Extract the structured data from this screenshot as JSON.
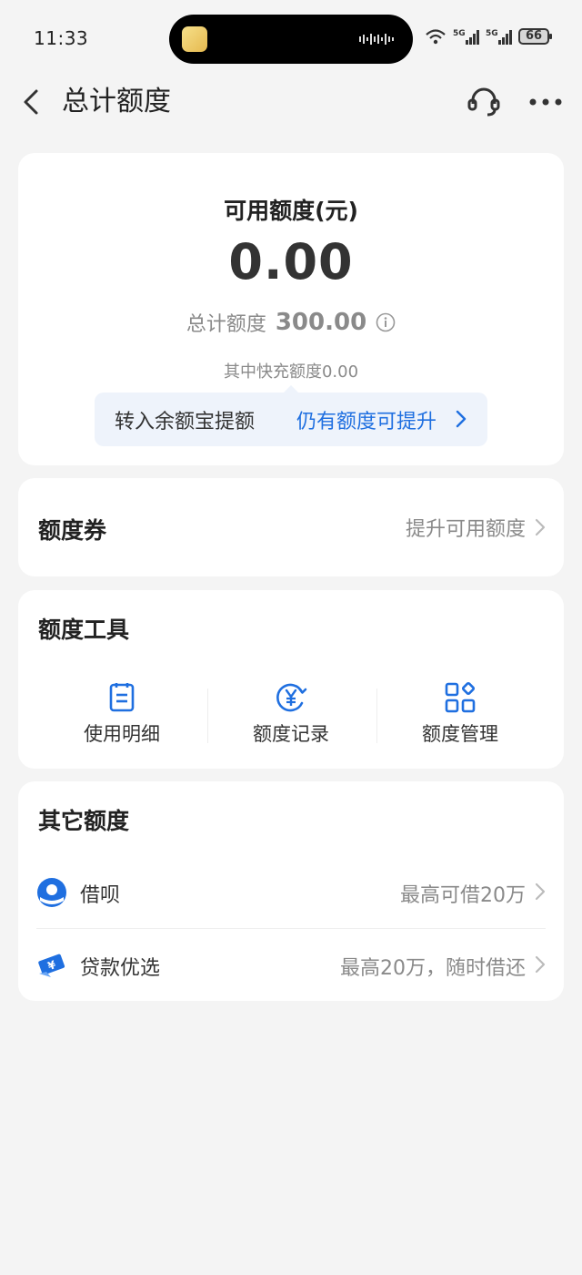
{
  "status_bar": {
    "time": "11:33",
    "battery": "66"
  },
  "nav": {
    "title": "总计额度"
  },
  "quota": {
    "available_label": "可用额度(元)",
    "available_amount": "0.00",
    "total_label": "总计额度",
    "total_value": "300.00",
    "fast_charge_note": "其中快充额度0.00",
    "promo_left": "转入余额宝提额",
    "promo_right": "仍有额度可提升"
  },
  "coupon": {
    "title": "额度券",
    "subtitle": "提升可用额度"
  },
  "tools": {
    "title": "额度工具",
    "items": [
      {
        "label": "使用明细",
        "icon": "document-list-icon"
      },
      {
        "label": "额度记录",
        "icon": "yuan-record-icon"
      },
      {
        "label": "额度管理",
        "icon": "grid-manage-icon"
      }
    ]
  },
  "other": {
    "title": "其它额度",
    "items": [
      {
        "name": "借呗",
        "subtitle": "最高可借20万",
        "icon": "jiebei-icon"
      },
      {
        "name": "贷款优选",
        "subtitle": "最高20万，随时借还",
        "icon": "loan-ticket-icon"
      }
    ]
  },
  "colors": {
    "accent_blue": "#1f6fe0",
    "background": "#f4f4f4",
    "promo_bg": "#eef3fb"
  }
}
